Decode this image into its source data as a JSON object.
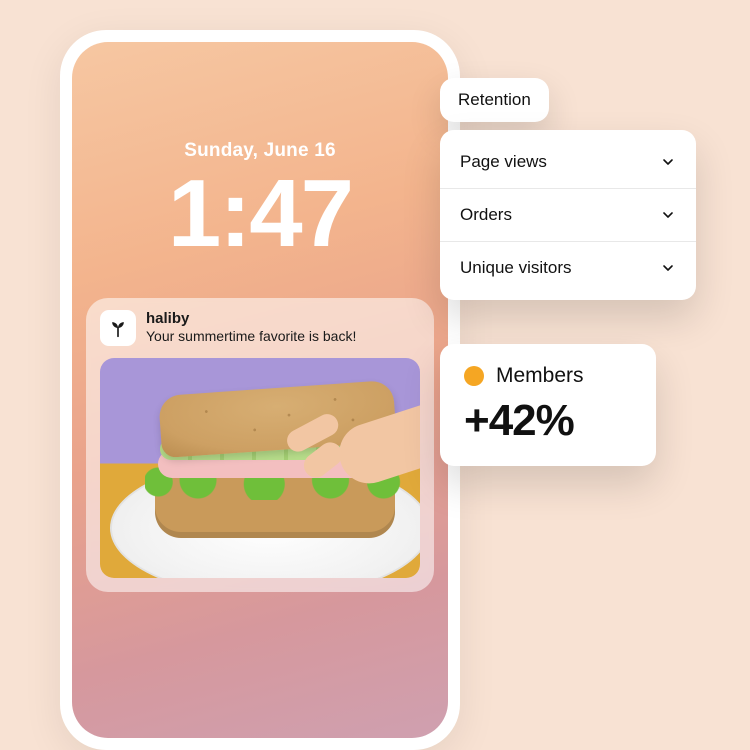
{
  "lockscreen": {
    "date": "Sunday, June 16",
    "time": "1:47"
  },
  "notification": {
    "app_name": "haliby",
    "message": "Your summertime favorite is back!",
    "icon_name": "sprout-icon"
  },
  "overlay": {
    "retention_label": "Retention",
    "metrics": [
      {
        "label": "Page views"
      },
      {
        "label": "Orders"
      },
      {
        "label": "Unique visitors"
      }
    ],
    "members": {
      "label": "Members",
      "delta": "+42%",
      "dot_color": "#f5a623"
    }
  }
}
